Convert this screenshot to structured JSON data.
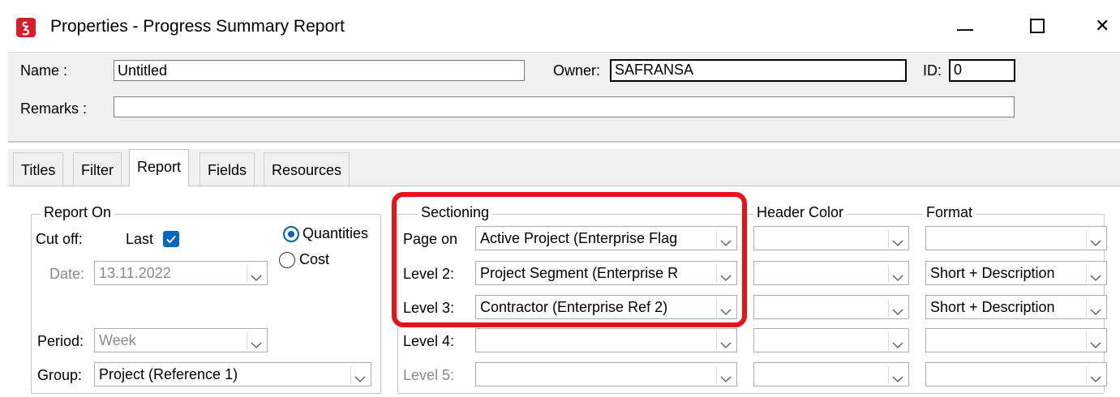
{
  "window": {
    "title": "Properties - Progress Summary Report",
    "icon": "safran-logo-icon",
    "buttons": {
      "minimize": "minimize-icon",
      "maximize": "maximize-icon",
      "close": "✕"
    }
  },
  "header": {
    "name_label": "Name :",
    "name_value": "Untitled",
    "owner_label": "Owner:",
    "owner_value": "SAFRANSA",
    "id_label": "ID:",
    "id_value": "0",
    "remarks_label": "Remarks :",
    "remarks_value": ""
  },
  "tabs": [
    {
      "label": "Titles"
    },
    {
      "label": "Filter"
    },
    {
      "label": "Report",
      "active": true
    },
    {
      "label": "Fields"
    },
    {
      "label": "Resources"
    }
  ],
  "report_on": {
    "title": "Report On",
    "cutoff_label": "Cut off:",
    "last_label": "Last",
    "last_checked": true,
    "quantities_label": "Quantities",
    "cost_label": "Cost",
    "selected_option": "Quantities",
    "date_label": "Date:",
    "date_value": "13.11.2022",
    "period_label": "Period:",
    "period_value": "Week",
    "group_label": "Group:",
    "group_value": "Project (Reference 1)"
  },
  "sectioning": {
    "title": "Sectioning",
    "header_color_title": "Header Color",
    "format_title": "Format",
    "rows": [
      {
        "label": "Page on",
        "value": "Active Project (Enterprise Flag",
        "header_color": "",
        "format": ""
      },
      {
        "label": "Level 2:",
        "value": "Project Segment (Enterprise R",
        "header_color": "",
        "format": "Short + Description"
      },
      {
        "label": "Level 3:",
        "value": "Contractor (Enterprise Ref 2)",
        "header_color": "",
        "format": "Short + Description"
      },
      {
        "label": "Level 4:",
        "value": "",
        "header_color": "",
        "format": ""
      },
      {
        "label": "Level 5:",
        "value": "",
        "header_color": "",
        "format": ""
      }
    ]
  },
  "colors": {
    "highlight": "#e8131a",
    "accent": "#0063b1",
    "panel": "#f0f0f0",
    "logo": "#d81f26"
  }
}
